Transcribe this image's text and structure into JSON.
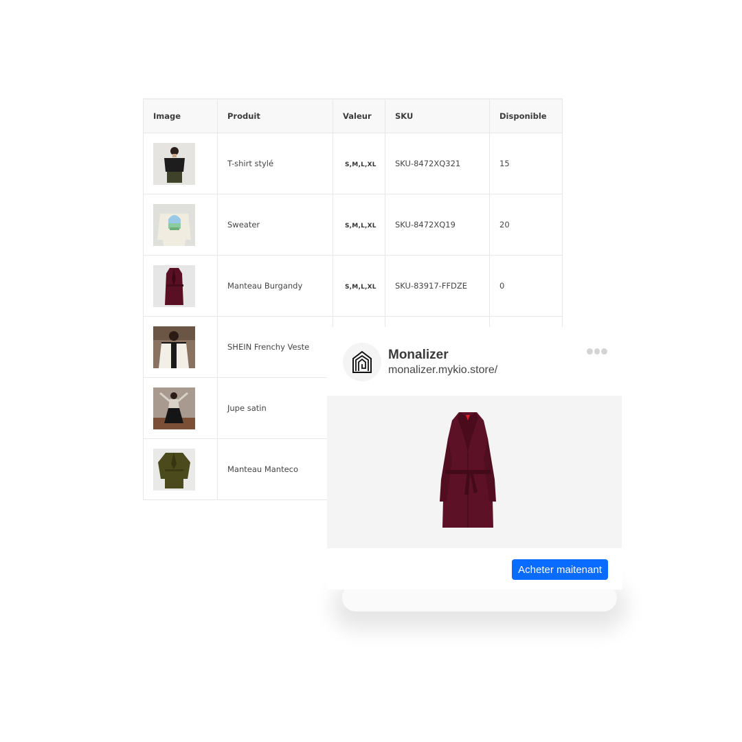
{
  "table": {
    "headers": {
      "image": "Image",
      "product": "Produit",
      "value": "Valeur",
      "sku": "SKU",
      "available": "Disponible"
    },
    "rows": [
      {
        "product": "T-shirt stylé",
        "value": "S,M,L,XL",
        "sku": "SKU-8472XQ321",
        "available": "15",
        "thumb_icon": "black-tshirt-model-photo"
      },
      {
        "product": "Sweater",
        "value": "S,M,L,XL",
        "sku": "SKU-8472XQ19",
        "available": "20",
        "thumb_icon": "cream-sweater-photo"
      },
      {
        "product": "Manteau Burgandy",
        "value": "S,M,L,XL",
        "sku": "SKU-83917-FFDZE",
        "available": "0",
        "thumb_icon": "burgundy-coat-photo"
      },
      {
        "product": "SHEIN Frenchy Veste",
        "value": "",
        "sku": "",
        "available": "",
        "thumb_icon": "tweed-jacket-model-photo"
      },
      {
        "product": "Jupe satin",
        "value": "",
        "sku": "",
        "available": "",
        "thumb_icon": "satin-skirt-model-photo"
      },
      {
        "product": "Manteau Manteco",
        "value": "",
        "sku": "",
        "available": "",
        "thumb_icon": "olive-coat-photo"
      }
    ]
  },
  "card": {
    "store_name": "Monalizer",
    "store_url": "monalizer.mykio.store/",
    "cta_label": "Acheter maitenant",
    "logo_icon": "house-monogram-logo",
    "menu_icon": "more-dots-icon",
    "preview_icon": "burgundy-coat-photo"
  },
  "colors": {
    "accent": "#0a6cff",
    "burgundy": "#5a1024",
    "olive": "#4a4a1c",
    "table_border": "#e7e7e7"
  }
}
